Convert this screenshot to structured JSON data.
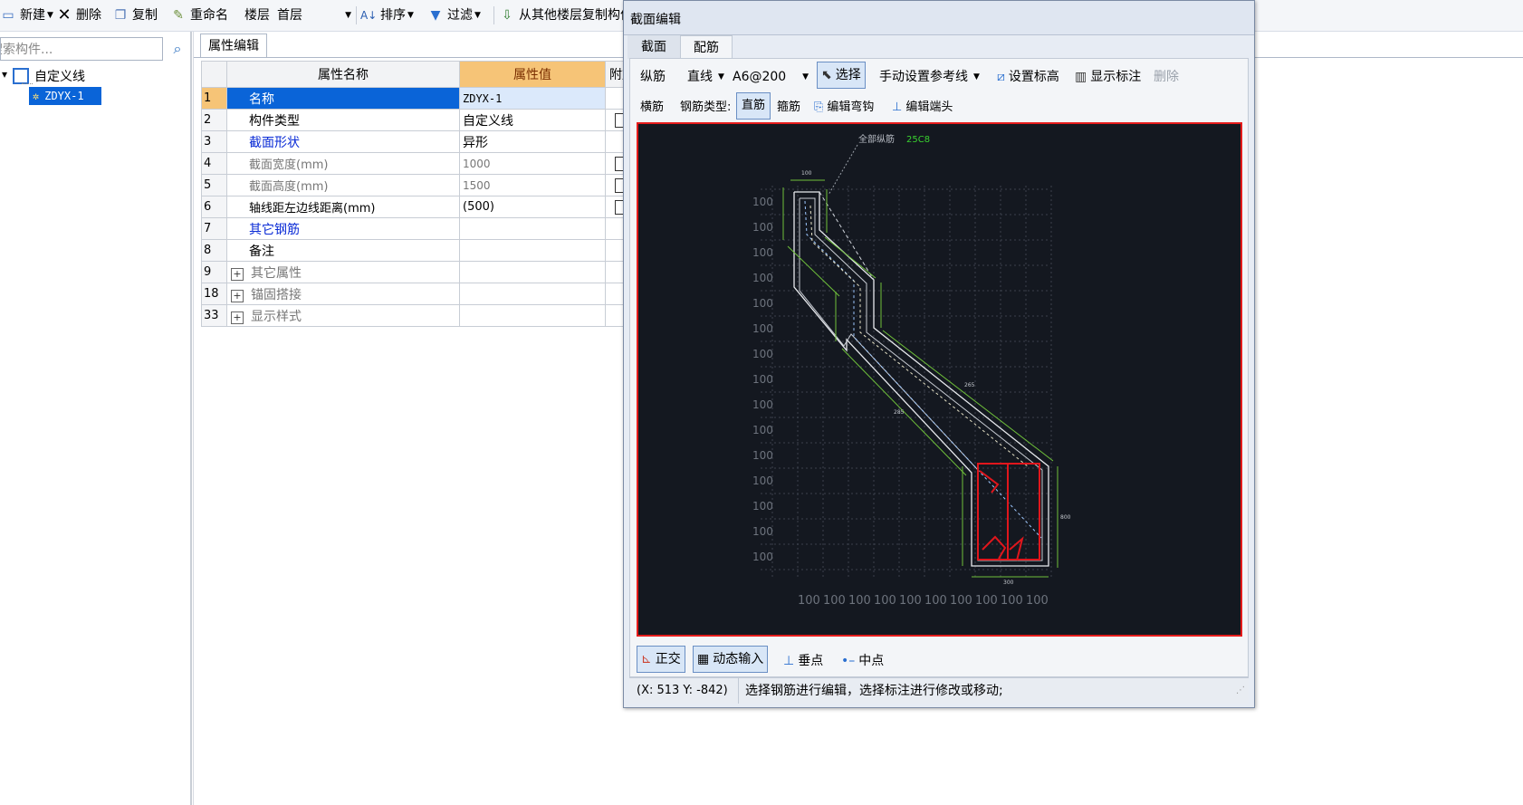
{
  "toolbar": {
    "new_label": "新建",
    "delete_label": "删除",
    "copy_label": "复制",
    "rename_label": "重命名",
    "floor_label": "楼层",
    "floor_value": "首层",
    "sort_label": "排序",
    "filter_label": "过滤",
    "copy_from_floor_label": "从其他楼层复制构件"
  },
  "left_panel": {
    "search_placeholder": "搜索构件...",
    "tree": {
      "root_label": "自定义线",
      "child_label": "ZDYX-1"
    }
  },
  "property_panel": {
    "tab_label": "属性编辑",
    "headers": {
      "name": "属性名称",
      "value": "属性值",
      "extra": "附加"
    },
    "rows": [
      {
        "num": "1",
        "name": "名称",
        "value": "ZDYX-1"
      },
      {
        "num": "2",
        "name": "构件类型",
        "value": "自定义线"
      },
      {
        "num": "3",
        "name": "截面形状",
        "value": "异形"
      },
      {
        "num": "4",
        "name": "截面宽度(mm)",
        "value": "1000"
      },
      {
        "num": "5",
        "name": "截面高度(mm)",
        "value": "1500"
      },
      {
        "num": "6",
        "name": "轴线距左边线距离(mm)",
        "value": "(500)"
      },
      {
        "num": "7",
        "name": "其它钢筋",
        "value": ""
      },
      {
        "num": "8",
        "name": "备注",
        "value": ""
      },
      {
        "num": "9",
        "name": "其它属性",
        "value": ""
      },
      {
        "num": "18",
        "name": "锚固搭接",
        "value": ""
      },
      {
        "num": "33",
        "name": "显示样式",
        "value": ""
      }
    ]
  },
  "dialog": {
    "title": "截面编辑",
    "tabs": [
      "截面",
      "配筋"
    ],
    "row1": {
      "longitudinal_label": "纵筋",
      "line_mode": "直线",
      "rebar_spec": "A6@200",
      "select_label": "选择",
      "manual_ref_label": "手动设置参考线",
      "set_elevation_label": "设置标高",
      "show_dim_label": "显示标注",
      "delete_label": "删除"
    },
    "row2": {
      "transverse_label": "横筋",
      "rebar_type_label": "钢筋类型:",
      "straight_label": "直筋",
      "stirrup_label": "箍筋",
      "edit_hook_label": "编辑弯钩",
      "edit_end_label": "编辑端头"
    },
    "canvas": {
      "annotation_label": "全部纵筋",
      "annotation_value": "25C8",
      "grid_label": "100",
      "dims": {
        "top_width": "100",
        "right_height": "800",
        "bottom_width": "300",
        "diag_long": "265",
        "diag_short": "285"
      }
    },
    "bottom_bar": {
      "ortho_label": "正交",
      "dynamic_input_label": "动态输入",
      "perp_label": "垂点",
      "mid_label": "中点"
    },
    "status": {
      "coords": "(X: 513 Y: -842)",
      "message": "选择钢筋进行编辑，选择标注进行修改或移动;"
    }
  },
  "colors": {
    "canvas_bg": "#141820",
    "canvas_border": "#e51b1b",
    "rebar_red": "#e0161c",
    "dim_green": "#6fc03a",
    "selected_row": "#0a64d8",
    "value_header": "#f6c477"
  }
}
